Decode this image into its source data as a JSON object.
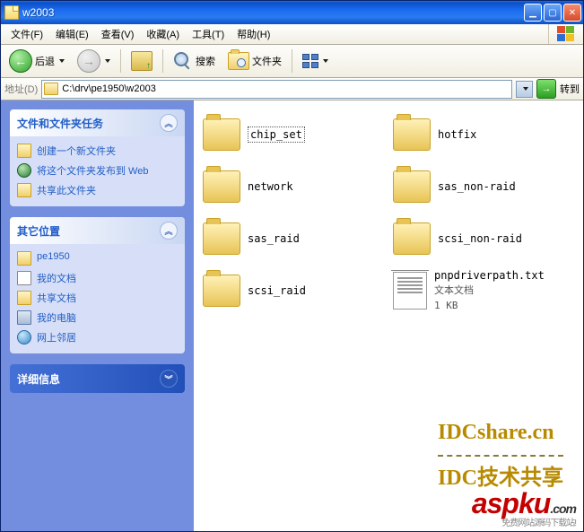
{
  "window": {
    "title": "w2003"
  },
  "menu": {
    "items": [
      "文件(F)",
      "编辑(E)",
      "查看(V)",
      "收藏(A)",
      "工具(T)",
      "帮助(H)"
    ]
  },
  "toolbar": {
    "back": "后退",
    "search": "搜索",
    "folders": "文件夹"
  },
  "address": {
    "label": "地址(D)",
    "path": "C:\\drv\\pe1950\\w2003",
    "go": "转到"
  },
  "sidebar": {
    "panel1": {
      "title": "文件和文件夹任务",
      "items": [
        "创建一个新文件夹",
        "将这个文件夹发布到 Web",
        "共享此文件夹"
      ]
    },
    "panel2": {
      "title": "其它位置",
      "items": [
        "pe1950",
        "我的文档",
        "共享文档",
        "我的电脑",
        "网上邻居"
      ]
    },
    "panel3": {
      "title": "详细信息"
    }
  },
  "files": {
    "items": [
      {
        "name": "chip_set",
        "type": "folder",
        "selected": true
      },
      {
        "name": "hotfix",
        "type": "folder"
      },
      {
        "name": "network",
        "type": "folder"
      },
      {
        "name": "sas_non-raid",
        "type": "folder"
      },
      {
        "name": "sas_raid",
        "type": "folder"
      },
      {
        "name": "scsi_non-raid",
        "type": "folder"
      },
      {
        "name": "scsi_raid",
        "type": "folder"
      },
      {
        "name": "pnpdriverpath.txt",
        "type": "txt",
        "desc": "文本文档",
        "size": "1 KB"
      }
    ]
  },
  "watermark": {
    "line1": "IDCshare.cn",
    "line2": "IDC技术共享"
  },
  "footer": {
    "brand_a": "aspku",
    "brand_b": ".com",
    "brand_c": "免费网站源码下载站!"
  }
}
